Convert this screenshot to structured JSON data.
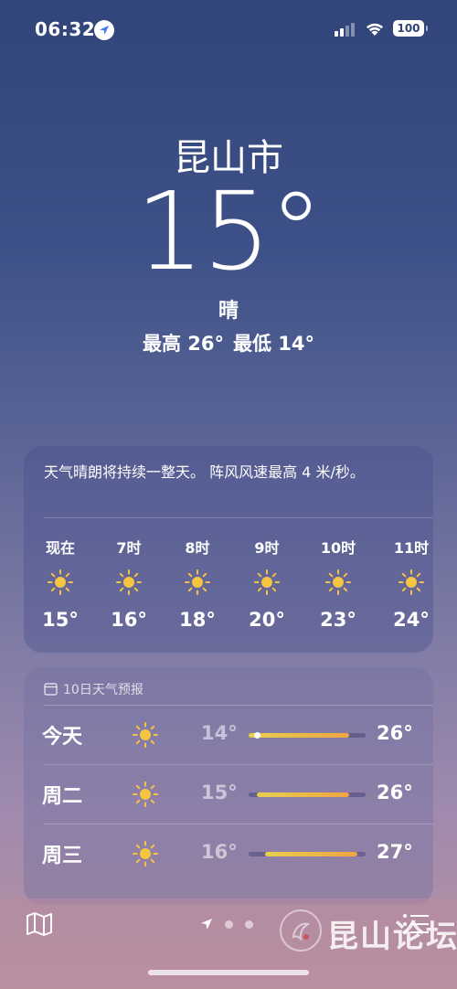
{
  "status": {
    "time": "06:32",
    "battery": "100"
  },
  "location": {
    "city": "昆山市",
    "temperature": "15°",
    "condition": "晴",
    "high": "最高 26°",
    "low": "最低 14°"
  },
  "hourly": {
    "summary": "天气晴朗将持续一整天。 阵风风速最高 4 米/秒。",
    "items": [
      {
        "label": "现在",
        "icon": "sun-icon",
        "temp": "15°"
      },
      {
        "label": "7时",
        "icon": "sun-icon",
        "temp": "16°"
      },
      {
        "label": "8时",
        "icon": "sun-icon",
        "temp": "18°"
      },
      {
        "label": "9时",
        "icon": "sun-icon",
        "temp": "20°"
      },
      {
        "label": "10时",
        "icon": "sun-icon",
        "temp": "23°"
      },
      {
        "label": "11时",
        "icon": "sun-icon",
        "temp": "24°"
      }
    ]
  },
  "daily": {
    "header": "10日天气预报",
    "range_min": 14,
    "range_max": 28,
    "current_temp": 15,
    "items": [
      {
        "day": "今天",
        "icon": "sun-icon",
        "low": "14°",
        "high": "26°",
        "low_val": 14,
        "high_val": 26
      },
      {
        "day": "周二",
        "icon": "sun-icon",
        "low": "15°",
        "high": "26°",
        "low_val": 15,
        "high_val": 26
      },
      {
        "day": "周三",
        "icon": "sun-icon",
        "low": "16°",
        "high": "27°",
        "low_val": 16,
        "high_val": 27
      }
    ]
  },
  "bottom": {
    "watermark": "昆山论坛",
    "page_count": 3,
    "active_page": 0
  },
  "colors": {
    "sun": "#f5c542",
    "bar_start": "#e8cf4f",
    "bar_end": "#f0a441"
  }
}
